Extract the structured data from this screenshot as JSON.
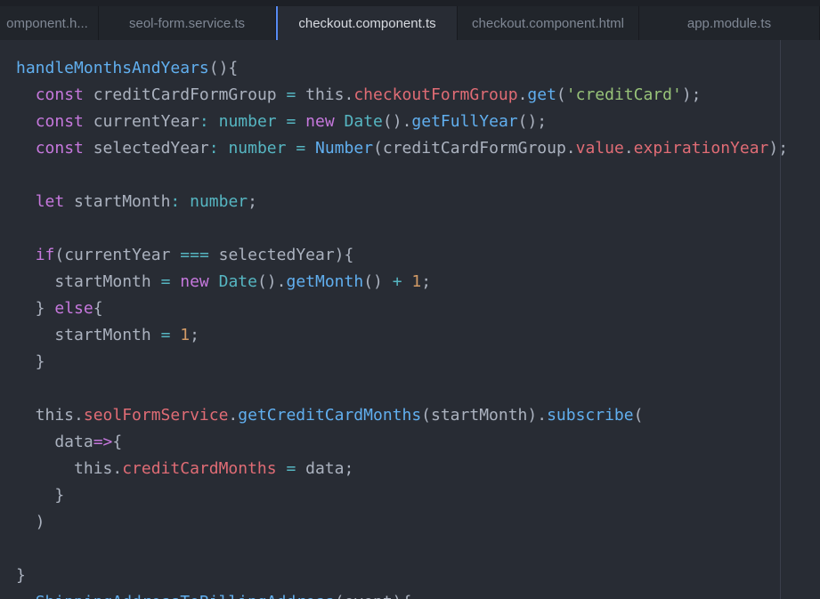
{
  "tabs": [
    {
      "label": "omponent.h..."
    },
    {
      "label": "seol-form.service.ts"
    },
    {
      "label": "checkout.component.ts"
    },
    {
      "label": "checkout.component.html"
    },
    {
      "label": "app.module.ts"
    }
  ],
  "active_tab": "checkout.component.ts",
  "colors": {
    "editor_background": "#282c34",
    "tabbar_background": "#21252b",
    "active_tab_indicator": "#568af2",
    "keyword": "#c678dd",
    "function": "#61afef",
    "property": "#e06c75",
    "type": "#56b6c2",
    "string": "#98c379",
    "number": "#d19a66",
    "plain": "#abb2bf"
  },
  "code_lines": [
    [
      {
        "t": "handleMonthsAndYears",
        "c": "f"
      },
      {
        "t": "(){"
      }
    ],
    [
      {
        "t": "  "
      },
      {
        "t": "const",
        "c": "k"
      },
      {
        "t": " creditCardFormGroup "
      },
      {
        "t": "=",
        "c": "o"
      },
      {
        "t": " this."
      },
      {
        "t": "checkoutFormGroup",
        "c": "p"
      },
      {
        "t": "."
      },
      {
        "t": "get",
        "c": "f"
      },
      {
        "t": "("
      },
      {
        "t": "'creditCard'",
        "c": "s"
      },
      {
        "t": ");"
      }
    ],
    [
      {
        "t": "  "
      },
      {
        "t": "const",
        "c": "k"
      },
      {
        "t": " currentYear"
      },
      {
        "t": ":",
        "c": "o"
      },
      {
        "t": " "
      },
      {
        "t": "number",
        "c": "t"
      },
      {
        "t": " "
      },
      {
        "t": "=",
        "c": "o"
      },
      {
        "t": " "
      },
      {
        "t": "new",
        "c": "k"
      },
      {
        "t": " "
      },
      {
        "t": "Date",
        "c": "t"
      },
      {
        "t": "()."
      },
      {
        "t": "getFullYear",
        "c": "f"
      },
      {
        "t": "();"
      }
    ],
    [
      {
        "t": "  "
      },
      {
        "t": "const",
        "c": "k"
      },
      {
        "t": " selectedYear"
      },
      {
        "t": ":",
        "c": "o"
      },
      {
        "t": " "
      },
      {
        "t": "number",
        "c": "t"
      },
      {
        "t": " "
      },
      {
        "t": "=",
        "c": "o"
      },
      {
        "t": " "
      },
      {
        "t": "Number",
        "c": "f"
      },
      {
        "t": "(creditCardFormGroup."
      },
      {
        "t": "value",
        "c": "p"
      },
      {
        "t": "."
      },
      {
        "t": "expirationYear",
        "c": "p"
      },
      {
        "t": ");"
      }
    ],
    [],
    [
      {
        "t": "  "
      },
      {
        "t": "let",
        "c": "k"
      },
      {
        "t": " startMonth"
      },
      {
        "t": ":",
        "c": "o"
      },
      {
        "t": " "
      },
      {
        "t": "number",
        "c": "t"
      },
      {
        "t": ";"
      }
    ],
    [],
    [
      {
        "t": "  "
      },
      {
        "t": "if",
        "c": "k"
      },
      {
        "t": "(currentYear "
      },
      {
        "t": "===",
        "c": "o"
      },
      {
        "t": " selectedYear){"
      }
    ],
    [
      {
        "t": "    startMonth "
      },
      {
        "t": "=",
        "c": "o"
      },
      {
        "t": " "
      },
      {
        "t": "new",
        "c": "k"
      },
      {
        "t": " "
      },
      {
        "t": "Date",
        "c": "t"
      },
      {
        "t": "()."
      },
      {
        "t": "getMonth",
        "c": "f"
      },
      {
        "t": "() "
      },
      {
        "t": "+",
        "c": "o"
      },
      {
        "t": " "
      },
      {
        "t": "1",
        "c": "n"
      },
      {
        "t": ";"
      }
    ],
    [
      {
        "t": "  } "
      },
      {
        "t": "else",
        "c": "k"
      },
      {
        "t": "{"
      }
    ],
    [
      {
        "t": "    startMonth "
      },
      {
        "t": "=",
        "c": "o"
      },
      {
        "t": " "
      },
      {
        "t": "1",
        "c": "n"
      },
      {
        "t": ";"
      }
    ],
    [
      {
        "t": "  }"
      }
    ],
    [],
    [
      {
        "t": "  this."
      },
      {
        "t": "seolFormService",
        "c": "p"
      },
      {
        "t": "."
      },
      {
        "t": "getCreditCardMonths",
        "c": "f"
      },
      {
        "t": "(startMonth)."
      },
      {
        "t": "subscribe",
        "c": "f"
      },
      {
        "t": "("
      }
    ],
    [
      {
        "t": "    data"
      },
      {
        "t": "=>",
        "c": "k"
      },
      {
        "t": "{"
      }
    ],
    [
      {
        "t": "      this."
      },
      {
        "t": "creditCardMonths",
        "c": "p"
      },
      {
        "t": " "
      },
      {
        "t": "=",
        "c": "o"
      },
      {
        "t": " data;"
      }
    ],
    [
      {
        "t": "    }"
      }
    ],
    [
      {
        "t": "  )"
      }
    ],
    [],
    [
      {
        "t": "}"
      }
    ],
    [
      {
        "t": "  "
      },
      {
        "t": "ShippingAddressToBillingAddress",
        "c": "f"
      },
      {
        "t": "(event){"
      }
    ]
  ]
}
